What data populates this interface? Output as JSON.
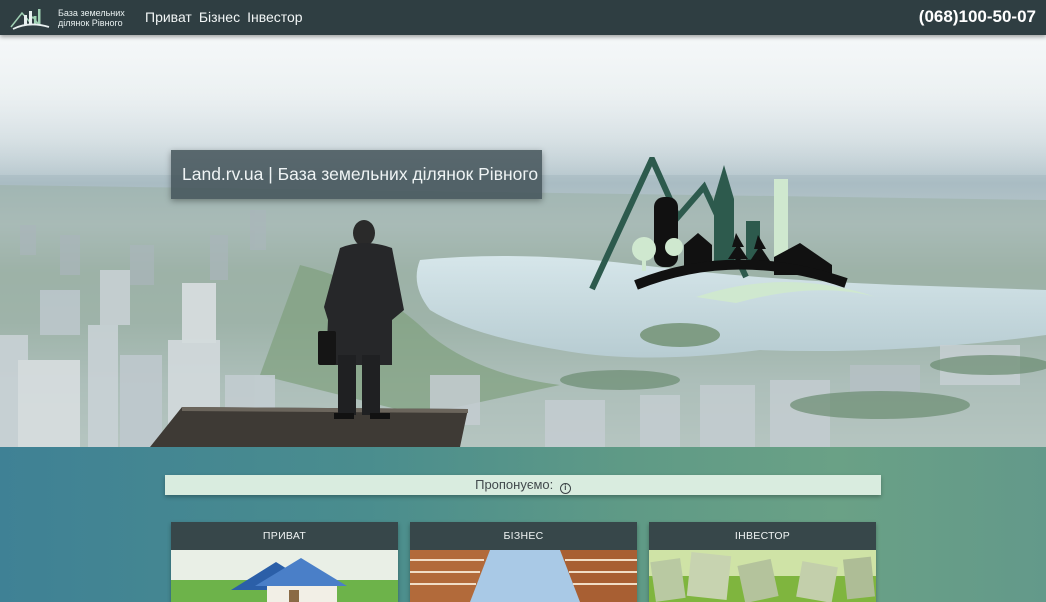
{
  "header": {
    "brand_line1": "База земельних",
    "brand_line2": "ділянок Рівного",
    "nav": [
      "Приват",
      "Бізнес",
      "Інвестор"
    ],
    "phone": "(068)100-50-07"
  },
  "hero": {
    "caption": "Land.rv.ua | База земельних ділянок Рівного"
  },
  "offers": {
    "label": "Пропонуємо:",
    "info_icon": "i",
    "cards": [
      {
        "title": "ПРИВАТ",
        "image": "house-photo"
      },
      {
        "title": "БІЗНЕС",
        "image": "skyscrapers-photo"
      },
      {
        "title": "ІНВЕСТОР",
        "image": "money-grass-photo"
      }
    ]
  },
  "colors": {
    "topbar": "#2f3e42",
    "logo_green": "#2d5a4d",
    "logo_light": "#cfe8cf",
    "card_head": "#37474a"
  }
}
